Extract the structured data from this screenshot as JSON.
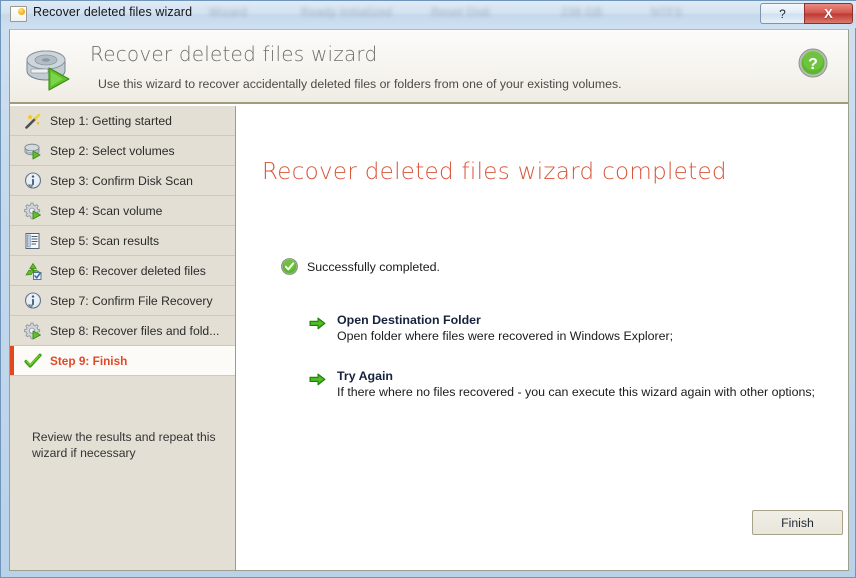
{
  "window": {
    "titlebar": {
      "title": "Recover deleted files wizard",
      "icon": "window-icon",
      "help_button_label": "?",
      "close_button_label": "X",
      "ghost_texts": [
        "Wizard",
        "Ready Initialized",
        "Reset Disk",
        "238 GB",
        "NTFS"
      ]
    }
  },
  "banner": {
    "title": "Recover deleted files wizard",
    "subtitle": "Use this wizard to recover accidentally deleted files or folders from one of your existing volumes.",
    "icon": "disk-run-icon",
    "help_icon": "help-question-icon"
  },
  "sidebar": {
    "steps": [
      {
        "label": "Step 1: Getting started",
        "icon": "magic-wand-icon",
        "active": false
      },
      {
        "label": "Step 2: Select volumes",
        "icon": "disk-run-icon",
        "active": false
      },
      {
        "label": "Step 3: Confirm Disk Scan",
        "icon": "info-icon",
        "active": false
      },
      {
        "label": "Step 4: Scan volume",
        "icon": "gear-run-icon",
        "active": false
      },
      {
        "label": "Step 5: Scan results",
        "icon": "report-list-icon",
        "active": false
      },
      {
        "label": "Step 6: Recover deleted files",
        "icon": "recycle-check-icon",
        "active": false
      },
      {
        "label": "Step 7: Confirm File Recovery",
        "icon": "info-icon",
        "active": false
      },
      {
        "label": "Step 8: Recover files and fold...",
        "icon": "gear-run-icon",
        "active": false
      },
      {
        "label": "Step 9: Finish",
        "icon": "green-check-icon",
        "active": true
      }
    ],
    "note": "Review the results and repeat this wizard if necessary"
  },
  "main": {
    "title": "Recover deleted files wizard completed",
    "status": {
      "icon": "success-check-icon",
      "text": "Successfully completed."
    },
    "actions": [
      {
        "icon": "green-arrow-icon",
        "title": "Open Destination Folder",
        "description": "Open folder where files were recovered in Windows Explorer;"
      },
      {
        "icon": "green-arrow-icon",
        "title": "Try Again",
        "description": "If there where no files recovered - you can execute this wizard again with other options;"
      }
    ],
    "finish_button": "Finish"
  },
  "colors": {
    "accent_red": "#e04a28",
    "title_orange": "#d9553a",
    "sidebar_bg": "#e3dfd5",
    "banner_border": "#a39b7e",
    "green": "#4ca81e"
  }
}
